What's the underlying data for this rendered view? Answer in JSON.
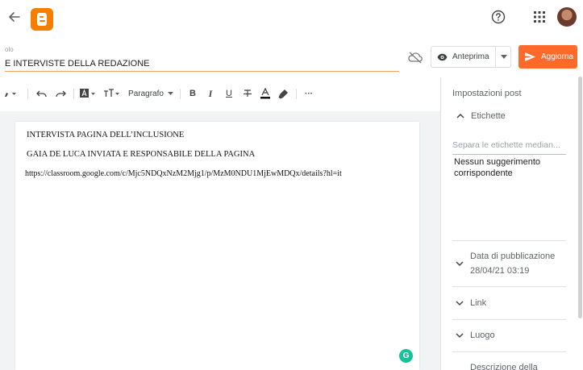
{
  "header": {
    "back_icon": "arrow-left-icon",
    "logo_icon": "blogger-logo",
    "help_icon": "help-circle-icon",
    "apps_icon": "apps-grid-icon",
    "avatar": "user-avatar"
  },
  "post": {
    "title_caption": "olo",
    "title_value": "E INTERVISTE DELLA REDAZIONE"
  },
  "actions": {
    "cloud_icon": "cloud-off-icon",
    "preview_label": "Anteprima",
    "preview_icon": "eye-icon",
    "update_label": "Aggiorna",
    "update_icon": "send-icon",
    "accent_color": "#ff6a2b"
  },
  "toolbar": {
    "paragraph_label": "Paragrafo",
    "bold": "B",
    "italic": "I",
    "underline": "U",
    "strike": "̶T",
    "more": "···"
  },
  "document": {
    "lines": [
      "INTERVISTA PAGINA DELL’INCLUSIONE",
      "GAIA DE LUCA INVIATA E RESPONSABILE DELLA PAGINA",
      "https://classroom.google.com/c/Mjc5NDQxNzM2Mjg1/p/MzM0NDU1MjEwMDQx/details?hl=it"
    ],
    "grammarly_letter": "G"
  },
  "panel": {
    "title": "Impostazioni post",
    "labels_section": "Etichette",
    "labels_placeholder": "Separa le etichette median...",
    "no_suggestions": "Nessun suggerimento corrispondente",
    "pubdate_label": "Data di pubblicazione",
    "pubdate_value": "28/04/21 03:19",
    "link_label": "Link",
    "location_label": "Luogo",
    "description_label": "Descrizione della"
  }
}
